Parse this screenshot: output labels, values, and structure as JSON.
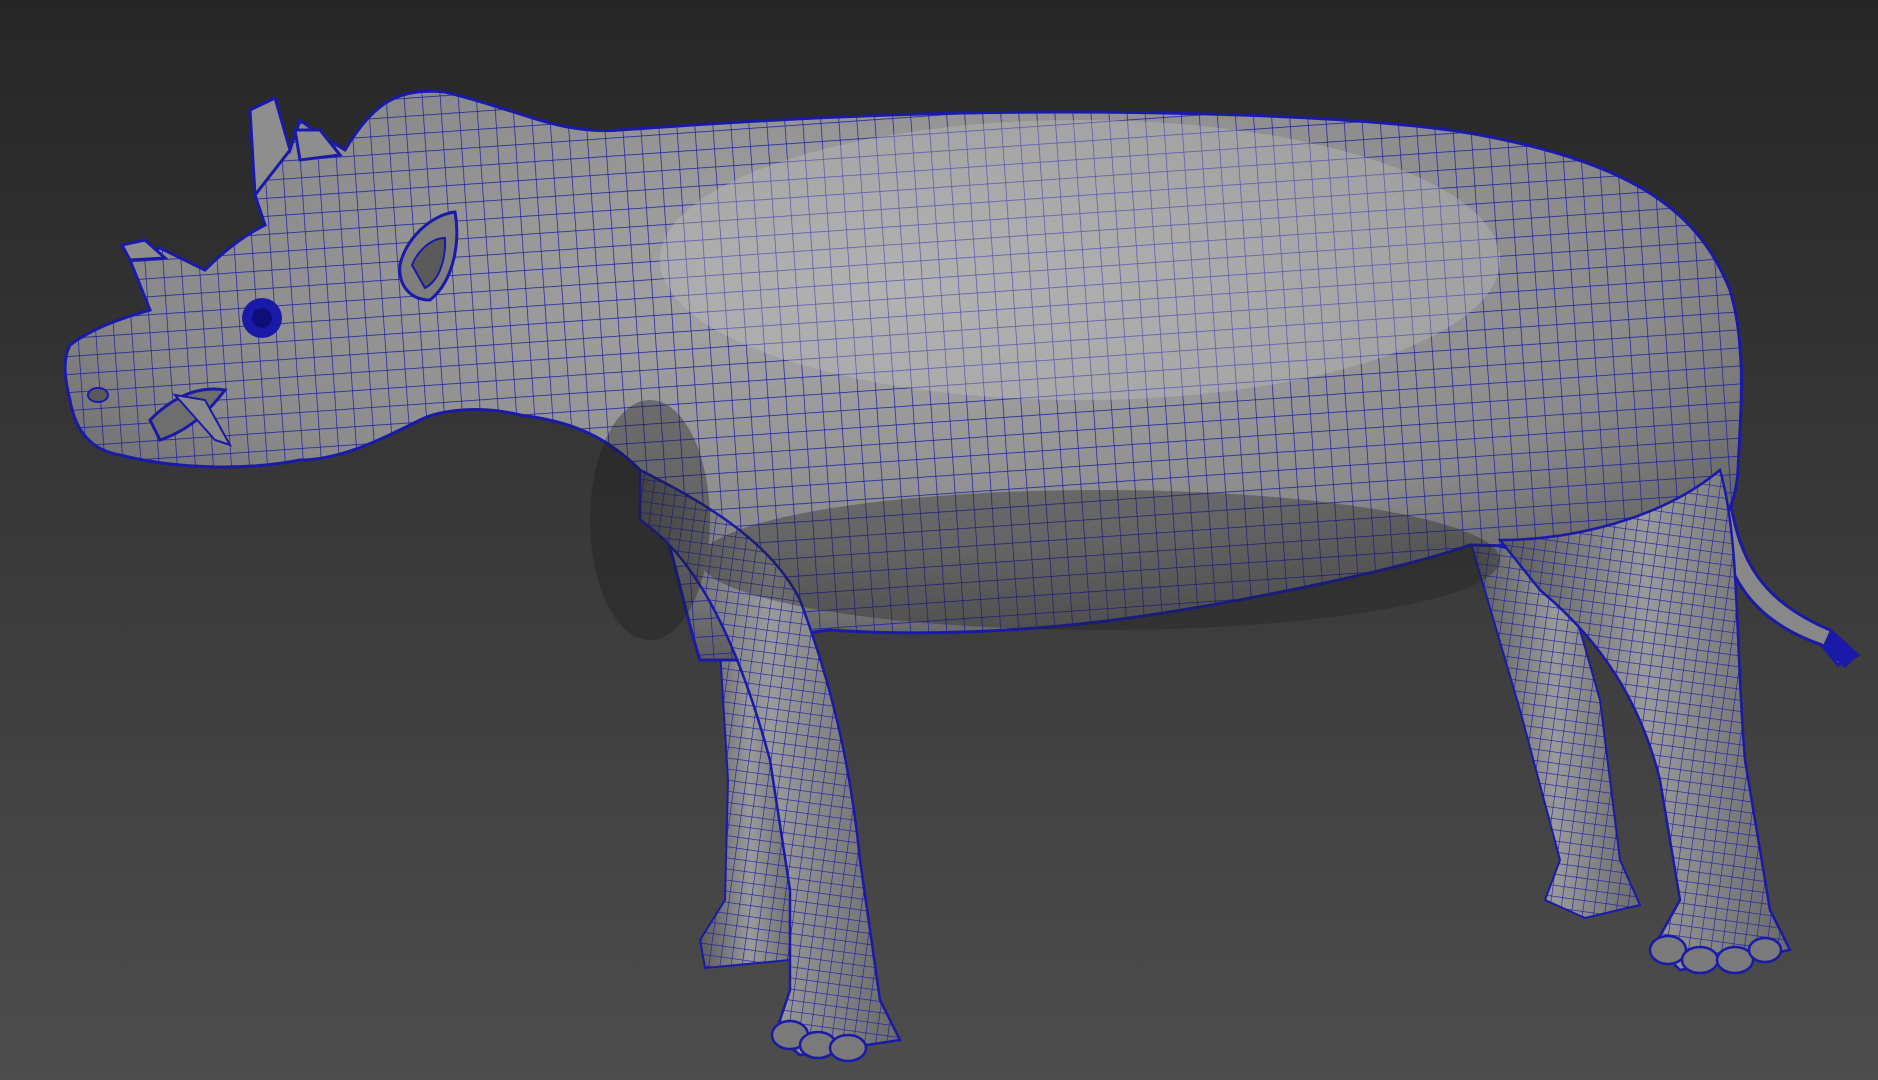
{
  "viewport": {
    "background_top": "#262626",
    "background_bottom": "#4d4d4d",
    "shading": "wireframe-on-shaded"
  },
  "model": {
    "subject": "quadruped-creature-icon",
    "surface_color": "#8c8c8c",
    "surface_light": "#a9a9a9",
    "surface_dark": "#3c3c3c",
    "wire_color": "#1a1aa8"
  }
}
